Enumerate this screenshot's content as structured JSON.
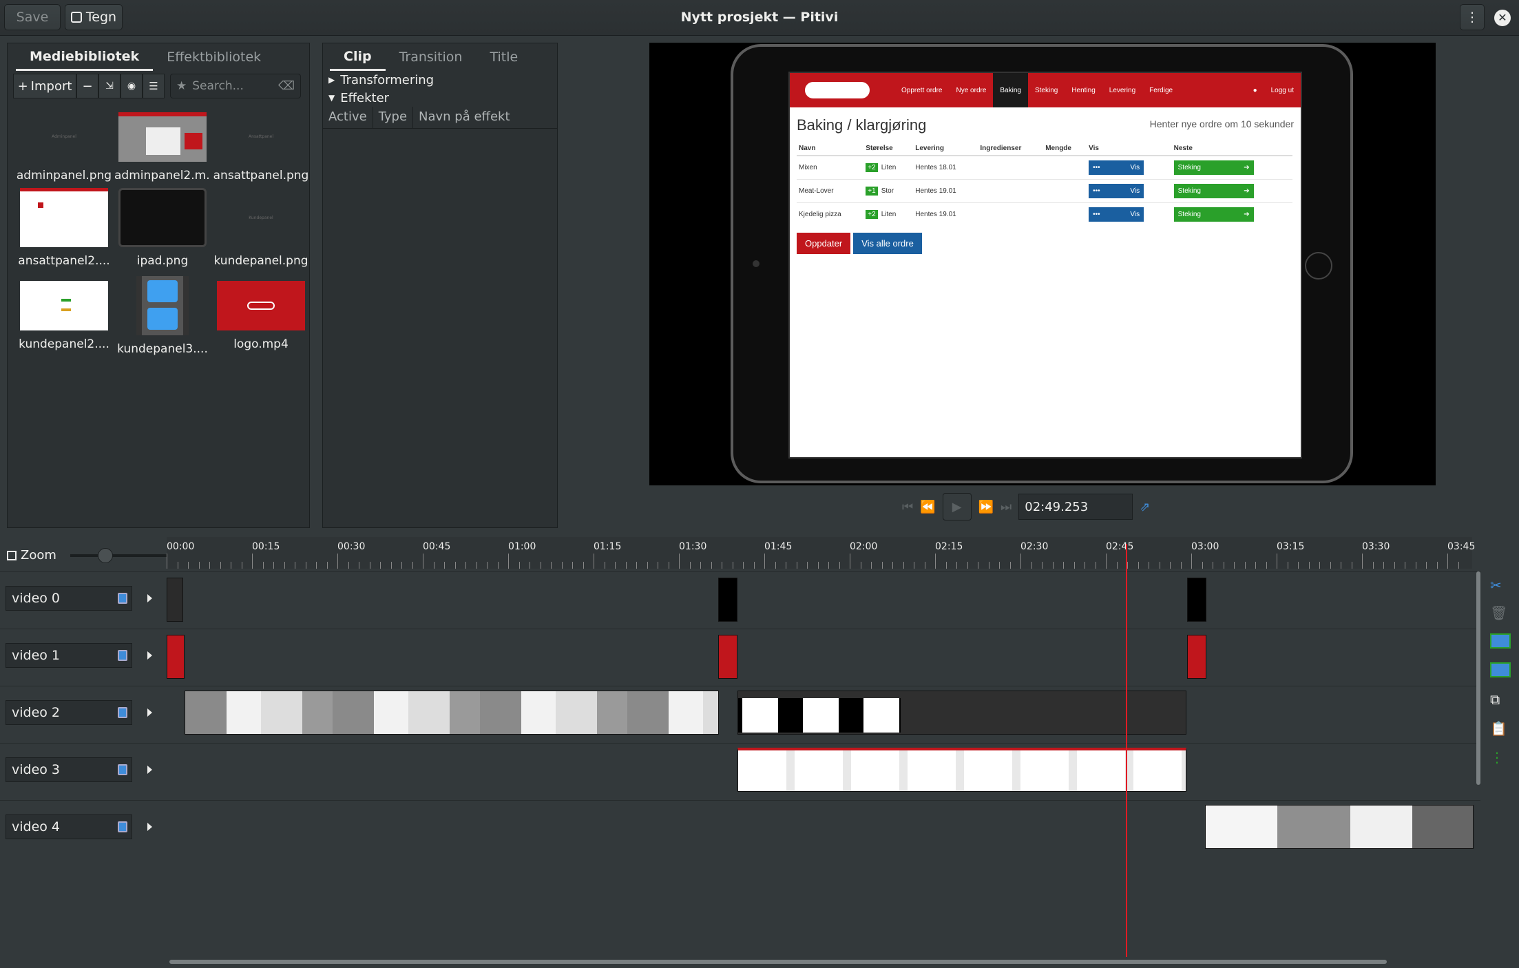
{
  "header": {
    "save_label": "Save",
    "draw_label": "Tegn",
    "title": "Nytt prosjekt — Pitivi"
  },
  "library": {
    "tabs": [
      "Mediebibliotek",
      "Effektbibliotek"
    ],
    "import_label": "Import",
    "search_placeholder": "Search...",
    "items": [
      {
        "label": "adminpanel.png"
      },
      {
        "label": "adminpanel2.m..."
      },
      {
        "label": "ansattpanel.png"
      },
      {
        "label": "ansattpanel2...."
      },
      {
        "label": "ipad.png"
      },
      {
        "label": "kundepanel.png"
      },
      {
        "label": "kundepanel2...."
      },
      {
        "label": "kundepanel3...."
      },
      {
        "label": "logo.mp4"
      }
    ]
  },
  "clip_panel": {
    "tabs": [
      "Clip",
      "Transition",
      "Title"
    ],
    "sections": [
      "Transformering",
      "Effekter"
    ],
    "columns": [
      "Active",
      "Type",
      "Navn på effekt"
    ]
  },
  "preview": {
    "nav": [
      "Opprett ordre",
      "Nye ordre",
      "Baking",
      "Steking",
      "Henting",
      "Levering",
      "Ferdige"
    ],
    "logout": "Logg ut",
    "heading": "Baking / klargjøring",
    "notice": "Henter nye ordre om 10 sekunder",
    "columns": [
      "Navn",
      "Størelse",
      "Levering",
      "Ingredienser",
      "Mengde",
      "Vis",
      "Neste"
    ],
    "rows": [
      {
        "name": "Mixen",
        "badge": "+2",
        "size": "Liten",
        "delivery": "Hentes 18.01"
      },
      {
        "name": "Meat-Lover",
        "badge": "+1",
        "size": "Stor",
        "delivery": "Hentes 19.01"
      },
      {
        "name": "Kjedelig pizza",
        "badge": "+2",
        "size": "Liten",
        "delivery": "Hentes 19.01"
      }
    ],
    "vis_label": "Vis",
    "next_label": "Steking",
    "dots": "•••",
    "btn_refresh": "Oppdater",
    "btn_all": "Vis alle ordre"
  },
  "transport": {
    "timecode": "02:49.253"
  },
  "timeline": {
    "zoom_label": "Zoom",
    "ticks": [
      "00:00",
      "00:15",
      "00:30",
      "00:45",
      "01:00",
      "01:15",
      "01:30",
      "01:45",
      "02:00",
      "02:15",
      "02:30",
      "02:45",
      "03:00",
      "03:15",
      "03:30",
      "03:45"
    ],
    "tracks": [
      "video 0",
      "video 1",
      "video 2",
      "video 3",
      "video 4"
    ]
  },
  "colors": {
    "accent_red": "#c0161c",
    "playhead": "#e01b24"
  }
}
